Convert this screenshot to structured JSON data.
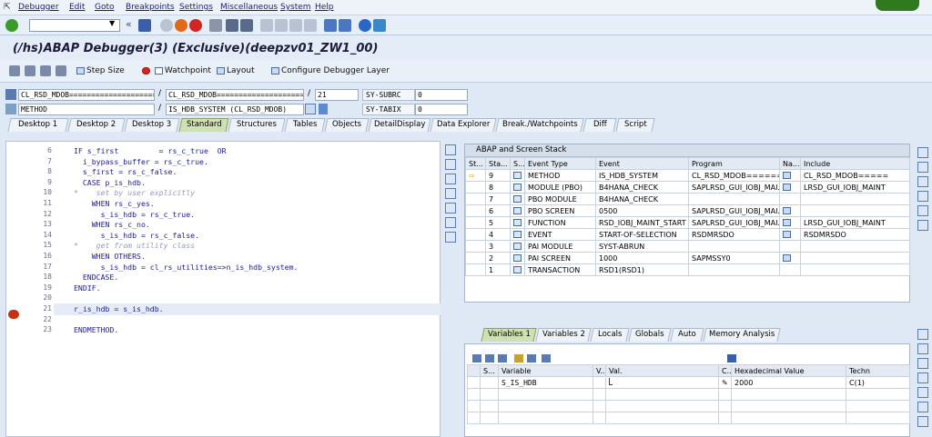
{
  "menubar": {
    "items": [
      "Debugger",
      "Edit",
      "Goto",
      "Breakpoints",
      "Settings",
      "Miscellaneous",
      "System",
      "Help"
    ]
  },
  "title": "(/hs)ABAP Debugger(3)  (Exclusive)(deepzv01_ZW1_00)",
  "toolbar2": {
    "step_size": "Step Size",
    "watchpoint": "Watchpoint",
    "layout": "Layout",
    "configure": "Configure Debugger Layer"
  },
  "fields": {
    "row1_a": "CL_RSD_MDOB====================",
    "row1_b": "CL_RSD_MDOB====================",
    "row1_line": "21",
    "row1_lbl": "SY-SUBRC",
    "row1_val": "0",
    "row2_type": "METHOD",
    "row2_name": "IS_HDB_SYSTEM (CL_RSD_MDOB)",
    "row2_lbl": "SY-TABIX",
    "row2_val": "0"
  },
  "tabs": [
    "Desktop 1",
    "Desktop 2",
    "Desktop 3",
    "Standard",
    "Structures",
    "Tables",
    "Objects",
    "DetailDisplay",
    "Data Explorer",
    "Break./Watchpoints",
    "Diff",
    "Script"
  ],
  "active_tab": "Standard",
  "code": [
    {
      "n": "6",
      "t": "IF s_first         = rs_c_true  OR"
    },
    {
      "n": "7",
      "t": "  i_bypass_buffer = rs_c_true."
    },
    {
      "n": "8",
      "t": "  s_first = rs_c_false."
    },
    {
      "n": "9",
      "t": "  CASE p_is_hdb."
    },
    {
      "n": "10",
      "t": "*    set by user explicitly"
    },
    {
      "n": "11",
      "t": "    WHEN rs_c_yes."
    },
    {
      "n": "12",
      "t": "      s_is_hdb = rs_c_true."
    },
    {
      "n": "13",
      "t": "    WHEN rs_c_no."
    },
    {
      "n": "14",
      "t": "      s_is_hdb = rs_c_false."
    },
    {
      "n": "15",
      "t": "*    get from utility class"
    },
    {
      "n": "16",
      "t": "    WHEN OTHERS."
    },
    {
      "n": "17",
      "t": "      s_is_hdb = cl_rs_utilities=>n_is_hdb_system."
    },
    {
      "n": "18",
      "t": "  ENDCASE."
    },
    {
      "n": "19",
      "t": "ENDIF."
    },
    {
      "n": "20",
      "t": ""
    },
    {
      "n": "21",
      "t": "r_is_hdb = s_is_hdb."
    },
    {
      "n": "22",
      "t": ""
    },
    {
      "n": "23",
      "t": "ENDMETHOD."
    }
  ],
  "stack": {
    "title": "ABAP and Screen Stack",
    "headers": [
      "St...",
      "Sta...",
      "S...",
      "Event Type",
      "Event",
      "Program",
      "Na...",
      "Include"
    ],
    "rows": [
      [
        "9",
        "METHOD",
        "IS_HDB_SYSTEM",
        "CL_RSD_MDOB=======",
        "CL_RSD_MDOB====="
      ],
      [
        "8",
        "MODULE (PBO)",
        "B4HANA_CHECK",
        "SAPLRSD_GUI_IOBJ_MAI...",
        "LRSD_GUI_IOBJ_MAINT"
      ],
      [
        "7",
        "PBO MODULE",
        "B4HANA_CHECK",
        "",
        ""
      ],
      [
        "6",
        "PBO SCREEN",
        "0500",
        "SAPLRSD_GUI_IOBJ_MAI...",
        ""
      ],
      [
        "5",
        "FUNCTION",
        "RSD_IOBJ_MAINT_START",
        "SAPLRSD_GUI_IOBJ_MAI...",
        "LRSD_GUI_IOBJ_MAINT"
      ],
      [
        "4",
        "EVENT",
        "START-OF-SELECTION",
        "RSDMRSDO",
        "RSDMRSDO"
      ],
      [
        "3",
        "PAI MODULE",
        "SYST-ABRUN",
        "",
        ""
      ],
      [
        "2",
        "PAI SCREEN",
        "1000",
        "SAPMSSY0",
        ""
      ],
      [
        "1",
        "TRANSACTION",
        "RSD1(RSD1)",
        "",
        ""
      ]
    ]
  },
  "vartabs": [
    "Variables 1",
    "Variables 2",
    "Locals",
    "Globals",
    "Auto",
    "Memory Analysis"
  ],
  "vars": {
    "headers": [
      "S...",
      "Variable",
      "V...",
      "Val.",
      "C...",
      "Hexadecimal Value",
      "Techn"
    ],
    "row": {
      "variable": "S_IS_HDB",
      "hex": "2000",
      "tech": "C(1)"
    }
  }
}
